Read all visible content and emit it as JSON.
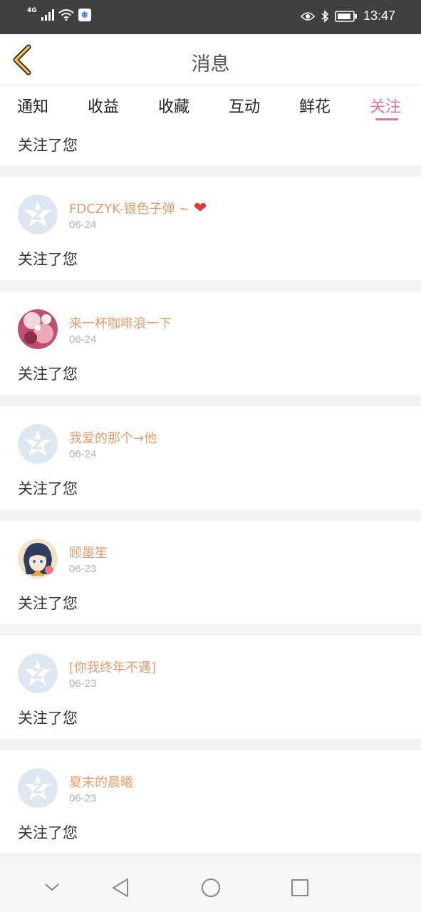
{
  "status_bar": {
    "network": "4G",
    "time": "13:47",
    "icons": [
      "signal-icon",
      "wifi-icon",
      "baidu-icon",
      "eye-icon",
      "bluetooth-icon",
      "battery-icon"
    ]
  },
  "header": {
    "title": "消息",
    "back_icon": "chevron-left-icon"
  },
  "tabs": [
    {
      "label": "通知",
      "active": false
    },
    {
      "label": "收益",
      "active": false
    },
    {
      "label": "收藏",
      "active": false
    },
    {
      "label": "互动",
      "active": false
    },
    {
      "label": "鲜花",
      "active": false
    },
    {
      "label": "关注",
      "active": true
    }
  ],
  "top_partial": {
    "message": "关注了您"
  },
  "items": [
    {
      "name": "FDCZYK-银色子弹 ~ ",
      "emoji": "❤",
      "date": "06-24",
      "message": "关注了您",
      "avatar": "default"
    },
    {
      "name": "来一杯咖啡浪一下",
      "date": "06-24",
      "message": "关注了您",
      "avatar": "photo-pink"
    },
    {
      "name": "我爱的那个→他",
      "date": "06-24",
      "message": "关注了您",
      "avatar": "default"
    },
    {
      "name": "顾墨笙",
      "date": "06-23",
      "message": "关注了您",
      "avatar": "photo-anime"
    },
    {
      "name": "[你我终年不遇]",
      "date": "06-23",
      "message": "关注了您",
      "avatar": "default"
    },
    {
      "name": "夏末的晨曦",
      "date": "06-23",
      "message": "关注了您",
      "avatar": "default"
    }
  ],
  "colors": {
    "accent": "#e275a4",
    "name": "#e39c6d",
    "date": "#b5b5b5",
    "status_bar": "#404040"
  },
  "nav_bar": [
    "chevron-down-icon",
    "back-triangle-icon",
    "home-circle-icon",
    "recents-square-icon"
  ]
}
